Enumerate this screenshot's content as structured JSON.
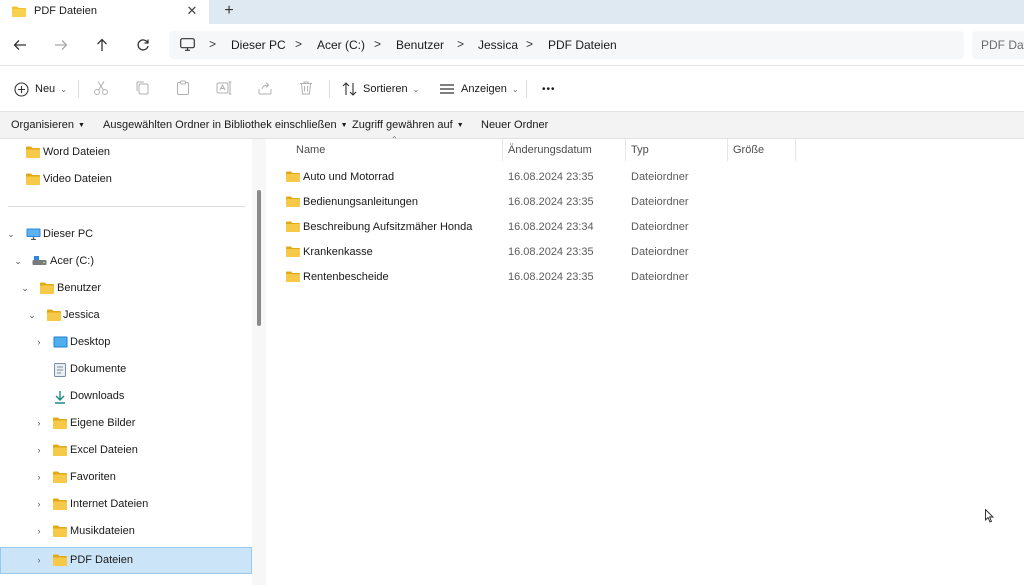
{
  "tab": {
    "title": "PDF Dateien",
    "close_glyph": "✕",
    "new_tab_glyph": "+"
  },
  "colors": {
    "folder": "#f4c12e",
    "folder_dark": "#e0a916",
    "selected_bg": "#cce4f7",
    "titlebar_bg": "#dfe9f2"
  },
  "nav_buttons": [
    "back-icon",
    "forward-icon",
    "up-icon",
    "refresh-icon"
  ],
  "breadcrumb": {
    "icon": "computer-icon",
    "items": [
      "Dieser PC",
      "Acer (C:)",
      "Benutzer",
      "Jessica",
      "PDF Dateien"
    ],
    "separator": ">"
  },
  "search": {
    "placeholder": "PDF Dat"
  },
  "commands": {
    "new_label": "Neu",
    "sort_label": "Sortieren",
    "view_label": "Anzeigen",
    "more_glyph": "•••",
    "disabled_icons": [
      "cut-icon",
      "copy-icon",
      "paste-icon",
      "rename-icon",
      "share-icon",
      "delete-icon"
    ]
  },
  "library_bar": {
    "organize": "Organisieren",
    "include_in_library": "Ausgewählten Ordner in Bibliothek einschließen",
    "share_access": "Zugriff gewähren auf",
    "new_folder": "Neuer Ordner"
  },
  "nav_tree": {
    "quick_items": [
      {
        "label": "Word Dateien",
        "icon": "folder-icon"
      },
      {
        "label": "Video Dateien",
        "icon": "folder-icon"
      }
    ],
    "items": [
      {
        "label": "Dieser PC",
        "icon": "computer-icon",
        "expander": "open"
      },
      {
        "label": "Acer (C:)",
        "icon": "drive-icon",
        "expander": "open"
      },
      {
        "label": "Benutzer",
        "icon": "folder-icon",
        "expander": "open"
      },
      {
        "label": "Jessica",
        "icon": "folder-icon",
        "expander": "open"
      },
      {
        "label": "Desktop",
        "icon": "desktop-icon",
        "expander": "closed"
      },
      {
        "label": "Dokumente",
        "icon": "document-icon",
        "expander": "none"
      },
      {
        "label": "Downloads",
        "icon": "download-icon",
        "expander": "none"
      },
      {
        "label": "Eigene Bilder",
        "icon": "folder-icon",
        "expander": "closed"
      },
      {
        "label": "Excel Dateien",
        "icon": "folder-icon",
        "expander": "closed"
      },
      {
        "label": "Favoriten",
        "icon": "folder-icon",
        "expander": "closed"
      },
      {
        "label": "Internet Dateien",
        "icon": "folder-icon",
        "expander": "closed"
      },
      {
        "label": "Musikdateien",
        "icon": "folder-icon",
        "expander": "closed"
      },
      {
        "label": "PDF Dateien",
        "icon": "folder-icon",
        "expander": "closed",
        "selected": true
      }
    ]
  },
  "file_list": {
    "columns": [
      "Name",
      "Änderungsdatum",
      "Typ",
      "Größe"
    ],
    "rows": [
      {
        "name": "Auto und Motorrad",
        "date": "16.08.2024 23:35",
        "type": "Dateiordner"
      },
      {
        "name": "Bedienungsanleitungen",
        "date": "16.08.2024 23:35",
        "type": "Dateiordner"
      },
      {
        "name": "Beschreibung Aufsitzmäher Honda",
        "date": "16.08.2024 23:34",
        "type": "Dateiordner"
      },
      {
        "name": "Krankenkasse",
        "date": "16.08.2024 23:35",
        "type": "Dateiordner"
      },
      {
        "name": "Rentenbescheide",
        "date": "16.08.2024 23:35",
        "type": "Dateiordner"
      }
    ]
  }
}
